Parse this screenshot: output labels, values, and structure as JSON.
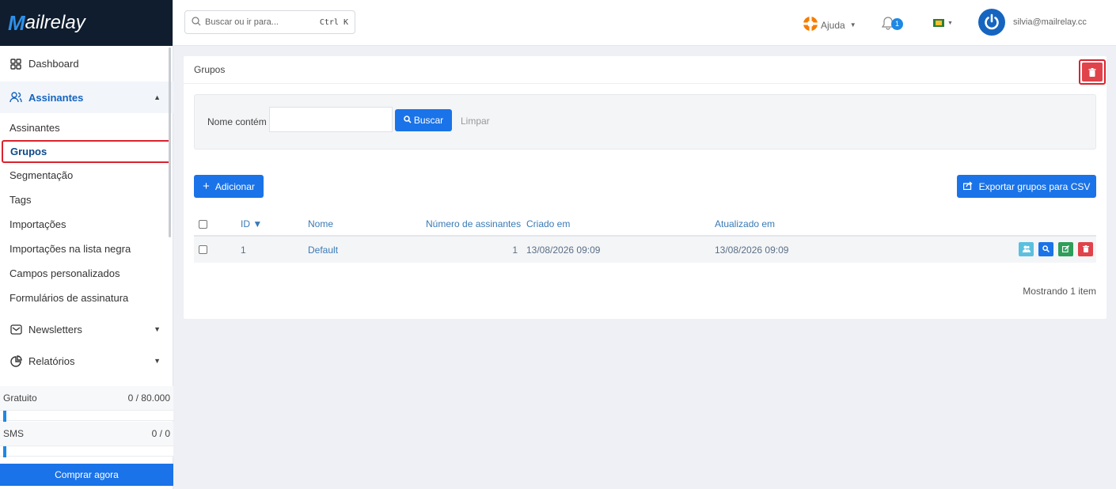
{
  "brand": {
    "logo_mark": "M",
    "logo_text": "ailrelay"
  },
  "search": {
    "placeholder": "Buscar ou ir para...",
    "shortcut": "Ctrl K"
  },
  "topbar": {
    "help_label": "Ajuda",
    "notification_count": "1",
    "user_email": "silvia@mailrelay.cc"
  },
  "sidebar": {
    "dashboard": "Dashboard",
    "subscribers_section": "Assinantes",
    "subitems": [
      "Assinantes",
      "Grupos",
      "Segmentação",
      "Tags",
      "Importações",
      "Importações na lista negra",
      "Campos personalizados",
      "Formulários de assinatura"
    ],
    "newsletters": "Newsletters",
    "reports": "Relatórios"
  },
  "quota": {
    "free_label": "Gratuito",
    "free_value": "0 / 80.000",
    "free_progress": 0,
    "sms_label": "SMS",
    "sms_value": "0 / 0",
    "sms_progress": 0,
    "buy_label": "Comprar agora"
  },
  "panel": {
    "title": "Grupos",
    "filter_label": "Nome contém",
    "search_button": "Buscar",
    "clear_button": "Limpar",
    "add_button": "Adicionar",
    "export_button": "Exportar grupos para CSV",
    "footer": "Mostrando 1 item"
  },
  "table": {
    "headers": {
      "id": "ID ▼",
      "name": "Nome",
      "subscribers": "Número de assinantes",
      "created": "Criado em",
      "updated": "Atualizado em"
    },
    "rows": [
      {
        "id": "1",
        "name": "Default",
        "subscribers": "1",
        "created": "13/08/2026 09:09",
        "updated": "13/08/2026 09:09"
      }
    ]
  },
  "colors": {
    "primary": "#1a73e8",
    "danger": "#e0434a",
    "success": "#2e9e5b",
    "info": "#5bc0de",
    "sidebar_dark": "#0f1d2e"
  }
}
